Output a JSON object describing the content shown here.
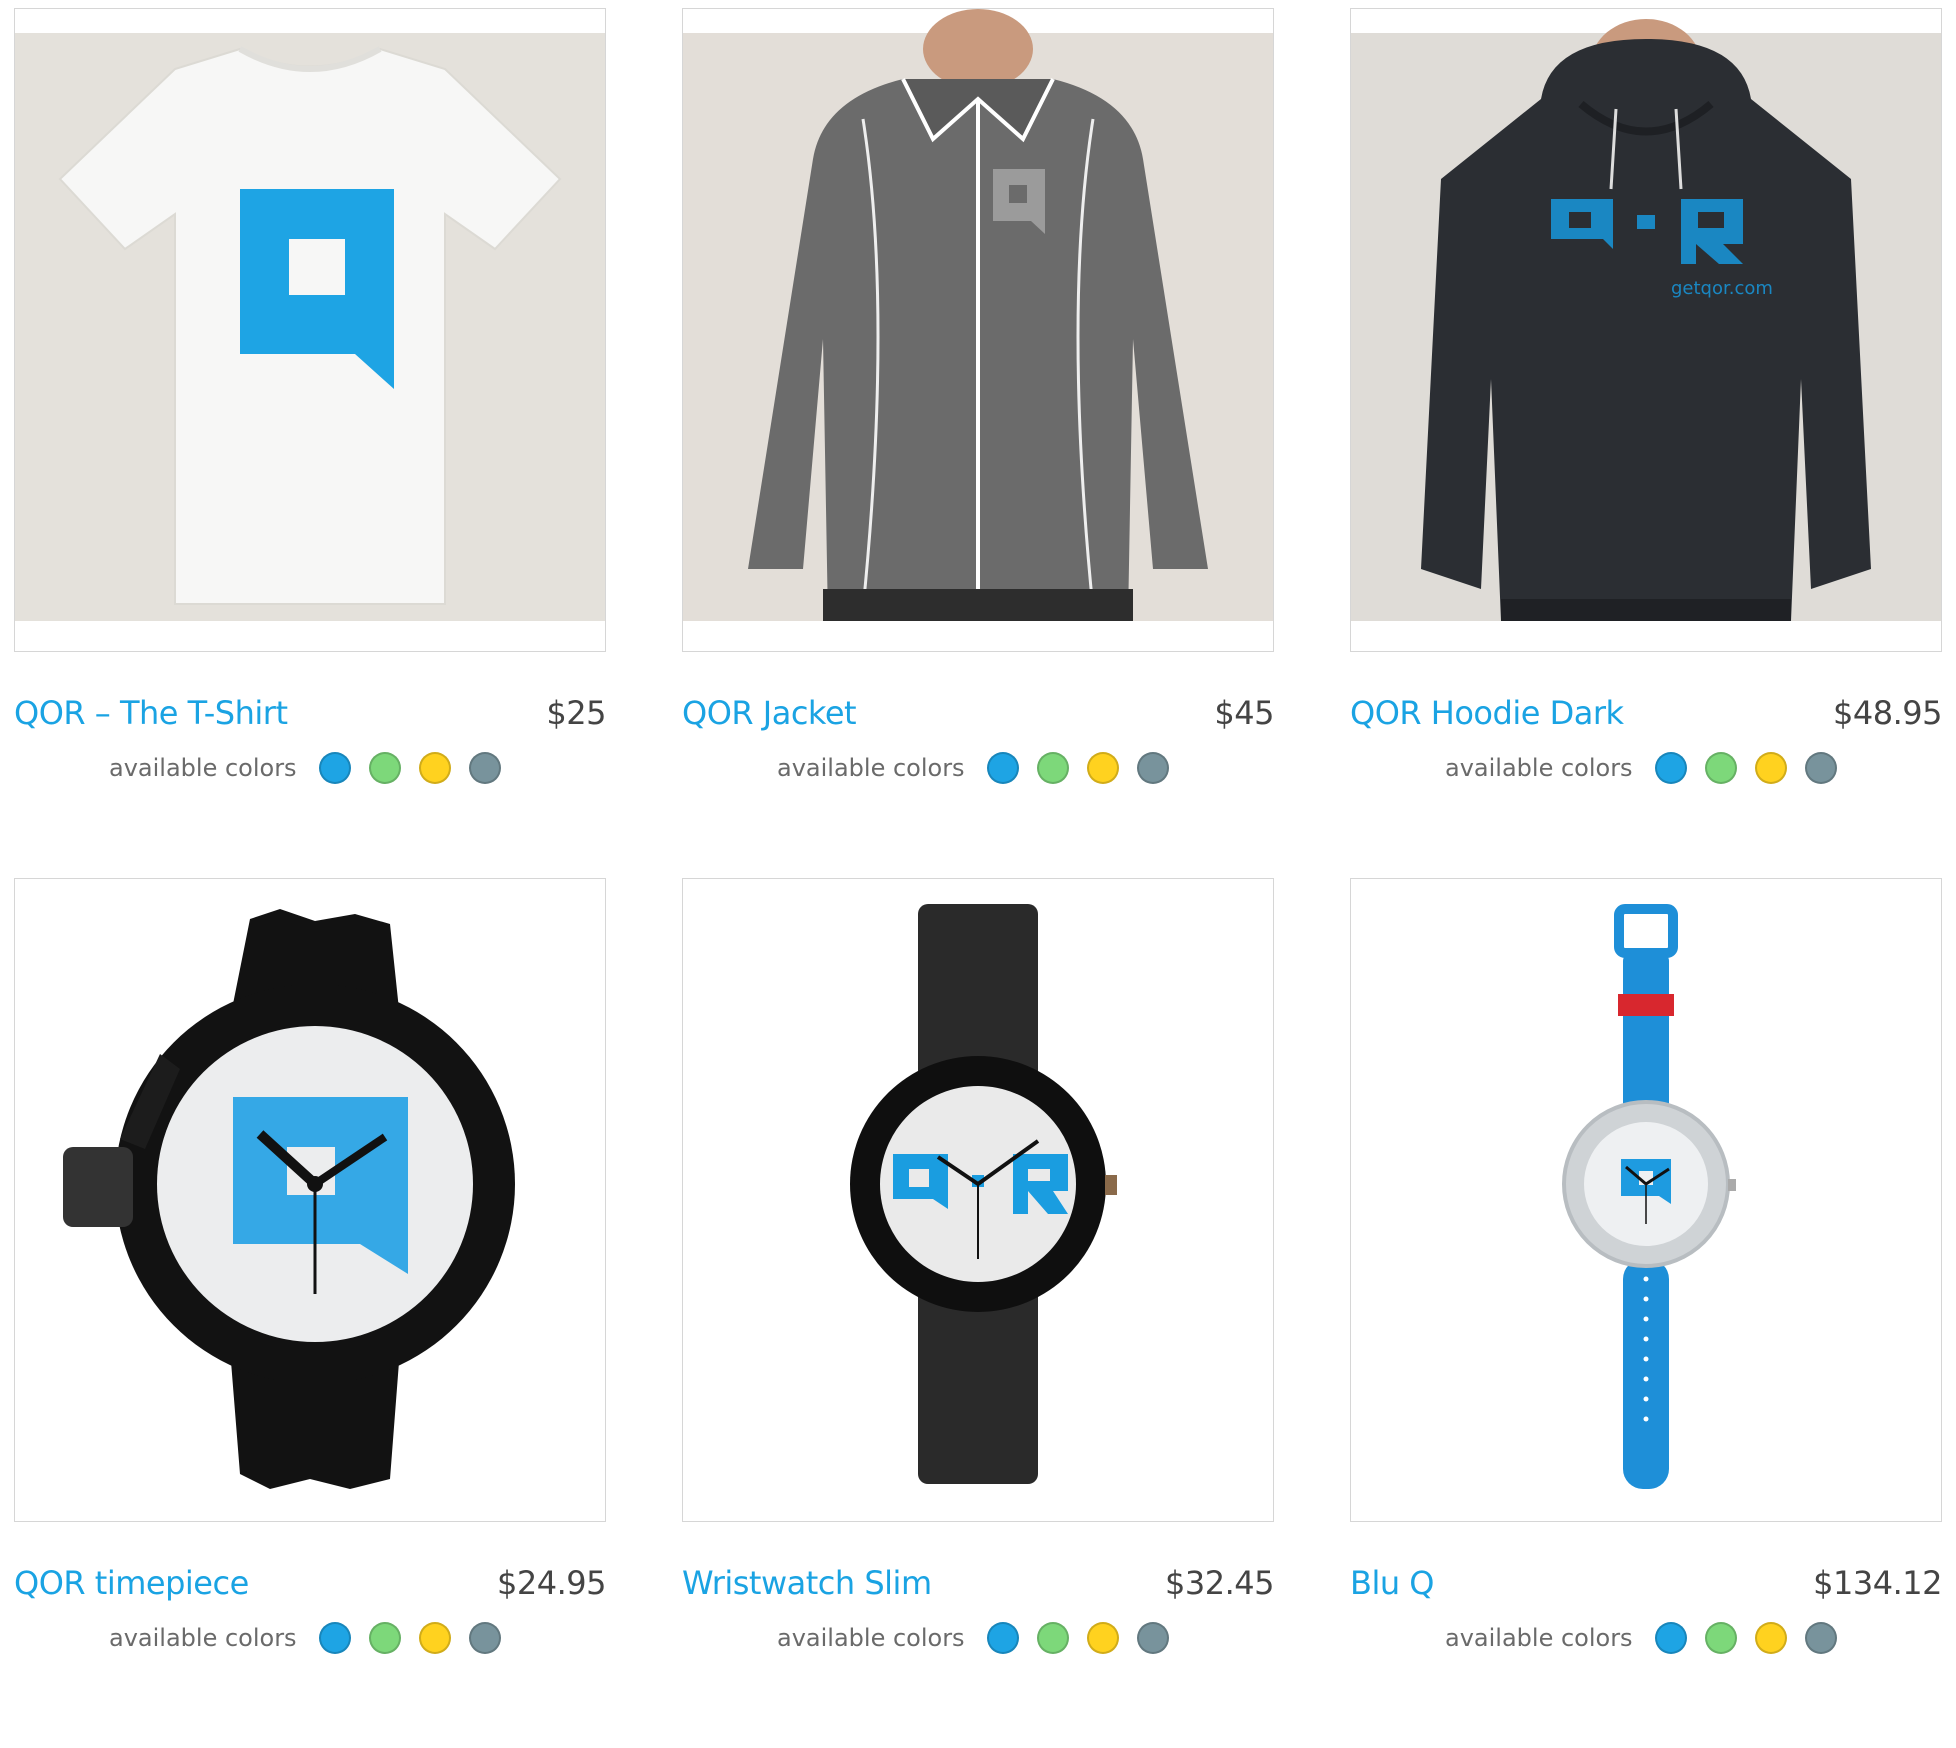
{
  "products": [
    {
      "title": "QOR – The T-Shirt",
      "price": "$25",
      "image": "white t-shirt with blue Q logo"
    },
    {
      "title": "QOR Jacket",
      "price": "$45",
      "image": "grey track jacket with grey Q logo"
    },
    {
      "title": "QOR Hoodie Dark",
      "price": "$48.95",
      "image": "dark hoodie with blue QOR logo"
    },
    {
      "title": "QOR timepiece",
      "price": "$24.95",
      "image": "black sport watch with blue Q dial"
    },
    {
      "title": "Wristwatch Slim",
      "price": "$32.45",
      "image": "slim black watch with QOR dial"
    },
    {
      "title": "Blu Q",
      "price": "$134.12",
      "image": "blue strap watch with Q dial"
    }
  ],
  "colors_label": "available colors",
  "swatch_colors": [
    "#1ea4e4",
    "#7dd87a",
    "#ffd21f",
    "#78939c"
  ],
  "logo_text": "getqor.com"
}
